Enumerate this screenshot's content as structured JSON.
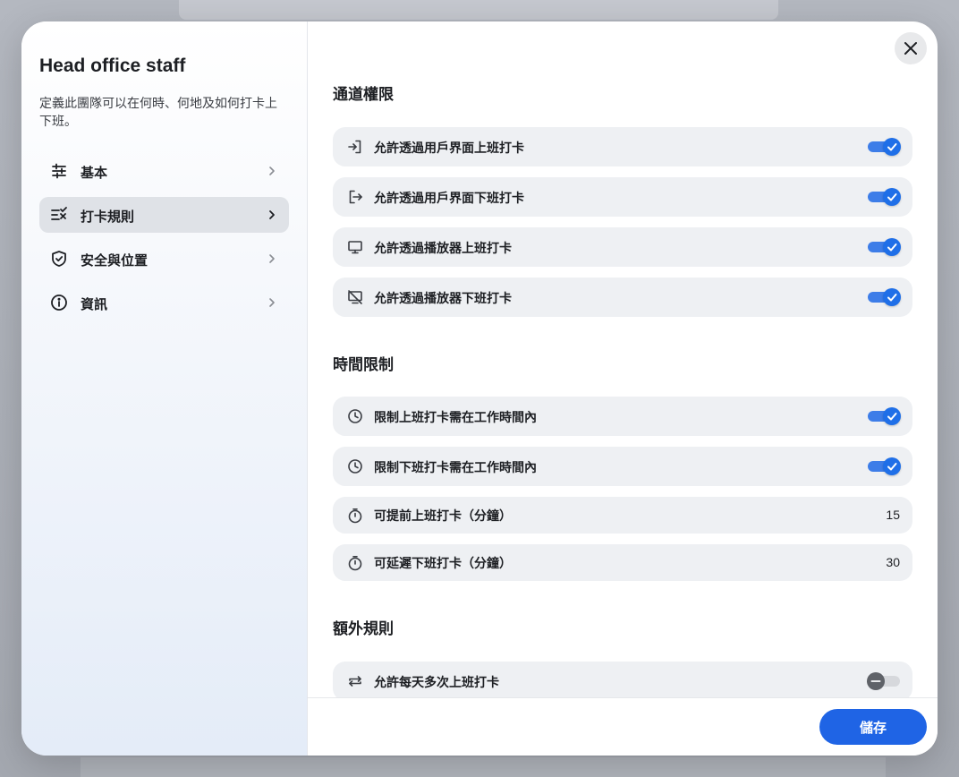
{
  "sidebar": {
    "title": "Head office staff",
    "description": "定義此團隊可以在何時、何地及如何打卡上下班。",
    "items": [
      {
        "label": "基本",
        "icon": "sliders-icon"
      },
      {
        "label": "打卡規則",
        "icon": "list-check-icon",
        "active": true
      },
      {
        "label": "安全與位置",
        "icon": "shield-check-icon"
      },
      {
        "label": "資訊",
        "icon": "info-icon"
      }
    ]
  },
  "content": {
    "sections": [
      {
        "title": "通道權限",
        "rows": [
          {
            "label": "允許透過用戶界面上班打卡",
            "icon": "login-icon",
            "toggle": true
          },
          {
            "label": "允許透過用戶界面下班打卡",
            "icon": "logout-icon",
            "toggle": true
          },
          {
            "label": "允許透過播放器上班打卡",
            "icon": "monitor-icon",
            "toggle": true
          },
          {
            "label": "允許透過播放器下班打卡",
            "icon": "monitor-off-icon",
            "toggle": true
          }
        ]
      },
      {
        "title": "時間限制",
        "rows": [
          {
            "label": "限制上班打卡需在工作時間內",
            "icon": "clock-icon",
            "toggle": true
          },
          {
            "label": "限制下班打卡需在工作時間內",
            "icon": "clock-icon",
            "toggle": true
          },
          {
            "label": "可提前上班打卡（分鐘）",
            "icon": "stopwatch-icon",
            "value": "15"
          },
          {
            "label": "可延遲下班打卡（分鐘）",
            "icon": "stopwatch-icon",
            "value": "30"
          }
        ]
      },
      {
        "title": "額外規則",
        "rows": [
          {
            "label": "允許每天多次上班打卡",
            "icon": "repeat-icon",
            "toggle": false
          }
        ]
      }
    ]
  },
  "footer": {
    "save_label": "儲存"
  },
  "colors": {
    "accent": "#1f64e5",
    "toggle_on": "#3d7de8",
    "row_bg": "#eef0f3"
  }
}
